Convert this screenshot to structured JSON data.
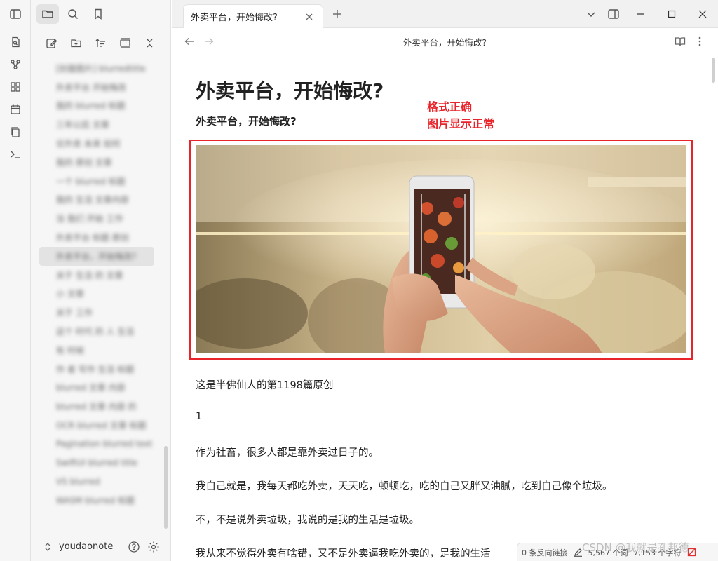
{
  "tab": {
    "title": "外卖平台，开始悔改?"
  },
  "view_header": {
    "title": "外卖平台，开始悔改?"
  },
  "file_items": [
    "[封面图片] blurredtitle",
    "外卖平台 开始悔改",
    "我的 blurred 标题",
    "三年以后 文章",
    "论外卖 未来 如何",
    "我的 原创 文章",
    "一个 blurred 标题",
    "我的 生活 文章内容",
    "当 我们 开始 工作",
    "外卖平台 标题 原创",
    "外卖平台，开始悔改?",
    "关于 生活 的 文章",
    "小 文章",
    "关于 工作",
    "这个 时代 的 人 生活",
    "有 时候",
    "作 者 写作 生活 标题",
    "blurred 文章 内容",
    "blurred 文章 内容 的",
    "OCR blurred 文章 标题",
    "Pagination blurred text",
    "SwiftUI blurred title",
    "VS blurred",
    "WASM blurred 标题"
  ],
  "vault": {
    "name": "youdaonote"
  },
  "doc": {
    "title": "外卖平台，开始悔改?",
    "subtitle": "外卖平台，开始悔改?",
    "annotation_line1": "格式正确",
    "annotation_line2": "图片显示正常",
    "paragraphs": [
      "这是半佛仙人的第1198篇原创",
      "1",
      "作为社畜，很多人都是靠外卖过日子的。",
      "我自己就是，我每天都吃外卖，天天吃，顿顿吃，吃的自己又胖又油腻，吃到自己像个垃圾。",
      "不，不是说外卖垃圾，我说的是我的生活是垃圾。",
      "我从来不觉得外卖有啥错，又不是外卖逼我吃外卖的，是我的生活"
    ]
  },
  "status": {
    "backlinks": "0 条反向链接",
    "words": "5,567 个词",
    "chars": "7,153 个字符"
  },
  "watermark": "CSDN @我就是孔邦德"
}
